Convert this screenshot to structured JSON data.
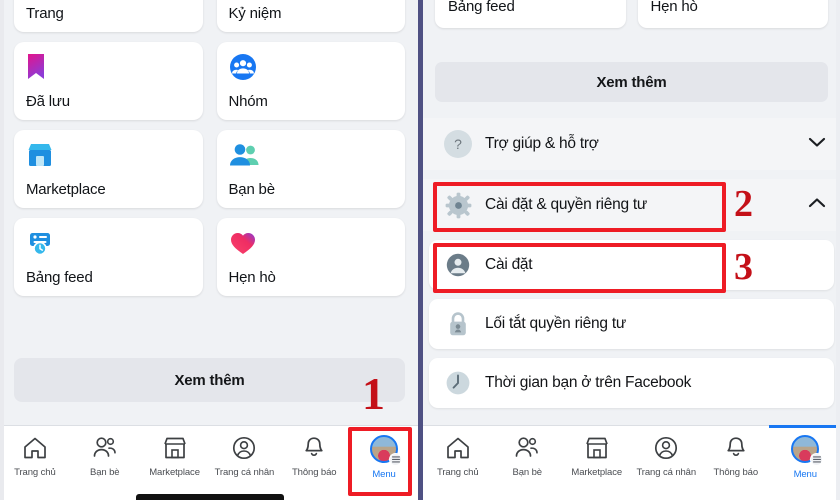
{
  "app": {
    "name": "Facebook",
    "accent_color": "#1877f2",
    "annotation_color": "#ee1c25",
    "background_color": "#f0f2f5"
  },
  "left_panel": {
    "name": "menu-grid-screen",
    "tiles": [
      {
        "label": "Trang",
        "icon": "flag-icon"
      },
      {
        "label": "Kỷ niệm",
        "icon": "clock-rewind-icon"
      },
      {
        "label": "Đã lưu",
        "icon": "bookmark-icon"
      },
      {
        "label": "Nhóm",
        "icon": "groups-icon"
      },
      {
        "label": "Marketplace",
        "icon": "storefront-icon"
      },
      {
        "label": "Bạn bè",
        "icon": "friends-icon"
      },
      {
        "label": "Bảng feed",
        "icon": "feed-icon"
      },
      {
        "label": "Hẹn hò",
        "icon": "heart-icon"
      }
    ],
    "see_more_label": "Xem thêm",
    "annotation": {
      "number": "1",
      "target": "menu-tab"
    }
  },
  "right_panel": {
    "name": "menu-settings-screen",
    "top_tiles": [
      {
        "label": "Bảng feed",
        "icon": "feed-icon"
      },
      {
        "label": "Hẹn hò",
        "icon": "heart-icon"
      }
    ],
    "see_more_label": "Xem thêm",
    "rows": [
      {
        "label": "Trợ giúp & hỗ trợ",
        "icon": "question-mark-icon",
        "chevron": "chevron-down-icon",
        "highlighted": false,
        "style": "flat"
      },
      {
        "label": "Cài đặt & quyền riêng tư",
        "icon": "gear-icon",
        "chevron": "chevron-up-icon",
        "highlighted": true,
        "style": "flat",
        "annotation": "2"
      },
      {
        "label": "Cài đặt",
        "icon": "person-circle-icon",
        "chevron": "",
        "highlighted": true,
        "style": "card",
        "annotation": "3"
      },
      {
        "label": "Lối tắt quyền riêng tư",
        "icon": "lock-icon",
        "chevron": "",
        "highlighted": false,
        "style": "card"
      },
      {
        "label": "Thời gian bạn ở trên Facebook",
        "icon": "clock-icon",
        "chevron": "",
        "highlighted": false,
        "style": "card"
      }
    ]
  },
  "bottom_nav": {
    "items": [
      {
        "label": "Trang chủ",
        "icon": "home-icon",
        "active": false
      },
      {
        "label": "Bạn bè",
        "icon": "friends-icon",
        "active": false
      },
      {
        "label": "Marketplace",
        "icon": "storefront-icon",
        "active": false
      },
      {
        "label": "Trang cá nhân",
        "icon": "profile-icon",
        "active": false
      },
      {
        "label": "Thông báo",
        "icon": "bell-icon",
        "active": false
      },
      {
        "label": "Menu",
        "icon": "avatar-menu-icon",
        "active": true
      }
    ]
  },
  "annotations": [
    {
      "number": "1",
      "describes": "menu-tab-in-bottom-nav"
    },
    {
      "number": "2",
      "describes": "settings-and-privacy-row"
    },
    {
      "number": "3",
      "describes": "settings-row"
    }
  ]
}
